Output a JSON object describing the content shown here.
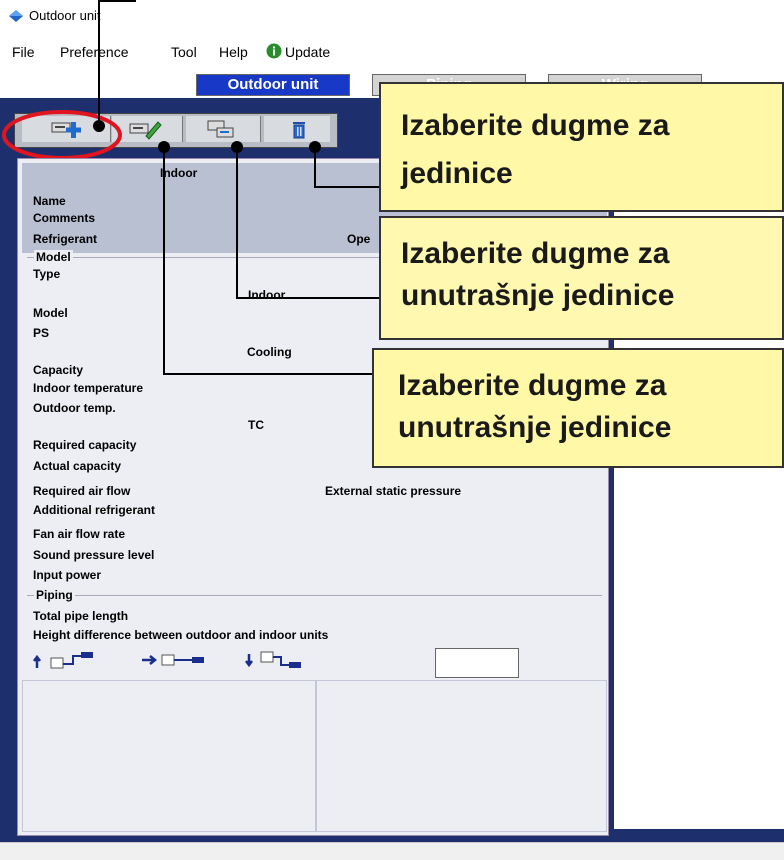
{
  "window": {
    "title": "Outdoor unit"
  },
  "menu": [
    {
      "label": "File"
    },
    {
      "label": "Preference"
    },
    {
      "label": "Tool"
    },
    {
      "label": "Help"
    },
    {
      "label": "Update"
    }
  ],
  "tabs": [
    {
      "label": "Outdoor unit"
    },
    {
      "label": "Piping"
    },
    {
      "label": "Wiring"
    }
  ],
  "toolbar": [
    {
      "icon": "add-indoor-icon"
    },
    {
      "icon": "edit-indoor-icon"
    },
    {
      "icon": "copy-indoor-icon"
    },
    {
      "icon": "delete-indoor-icon"
    }
  ],
  "panel": {
    "header": "Indoor",
    "name": "Name",
    "comments": "Comments",
    "refrigerant": "Refrigerant",
    "oper": "Ope",
    "model_section": "Model",
    "type": "Type",
    "type_indoor": "Indoor",
    "model": "Model",
    "ps": "PS",
    "cooling": "Cooling",
    "capacity": "Capacity",
    "indoor_temperature": "Indoor temperature",
    "outdoor_temp": "Outdoor temp.",
    "tc": "TC",
    "required_capacity": "Required capacity",
    "actual_capacity": "Actual capacity",
    "required_air_flow": "Required air flow",
    "external_static_pressure": "External static pressure",
    "additional_refrigerant": "Additional refrigerant",
    "fan_air_flow_rate": "Fan air flow rate",
    "sound_pressure_level": "Sound pressure level",
    "input_power": "Input power",
    "piping_section": "Piping",
    "total_pipe_length": "Total pipe length",
    "height_difference": "Height difference between outdoor and indoor units"
  },
  "callouts": [
    {
      "line1": "Izaberite dugme za",
      "line2": "jedinice"
    },
    {
      "line1": "Izaberite dugme za",
      "line2": "unutrašnje jedinice"
    },
    {
      "line1": "Izaberite dugme za",
      "line2": "unutrašnje jedinice"
    }
  ],
  "colors": {
    "accent": "#1a2e8c",
    "callout_bg": "#fff8a6",
    "highlight": "#e0151f"
  }
}
